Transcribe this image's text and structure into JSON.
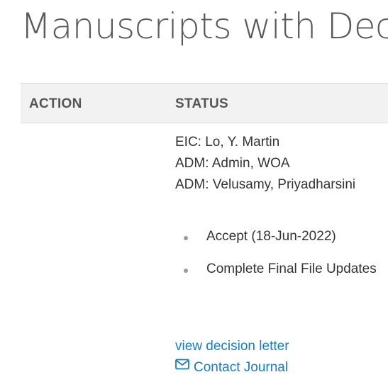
{
  "page": {
    "title": "Manuscripts with Decis"
  },
  "table": {
    "headers": {
      "action": "ACTION",
      "status": "STATUS"
    }
  },
  "status": {
    "people": [
      "EIC: Lo, Y. Martin",
      "ADM: Admin, WOA",
      "ADM: Velusamy, Priyadharsini"
    ],
    "decisions": [
      "Accept (18-Jun-2022)",
      "Complete Final File Updates"
    ],
    "links": {
      "view_decision_letter": "view decision letter",
      "contact_journal": "Contact Journal"
    }
  },
  "colors": {
    "link": "#1a7db8",
    "header_bg": "#f2f2f2",
    "title": "#5a5a5a"
  },
  "icons": {
    "contact": "envelope-icon",
    "list_bullet": "bullet-icon"
  }
}
